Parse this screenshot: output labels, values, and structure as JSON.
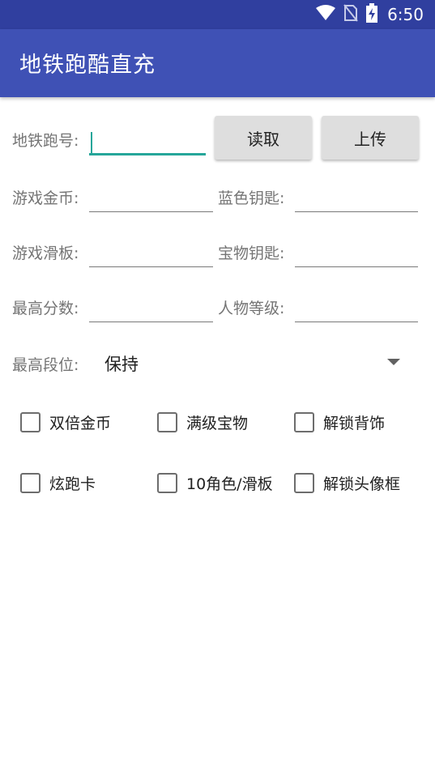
{
  "status_bar": {
    "time": "6:50",
    "icons": [
      "wifi-icon",
      "no-sim-icon",
      "battery-charging-icon"
    ]
  },
  "app_bar": {
    "title": "地铁跑酷直充"
  },
  "form": {
    "id_label": "地铁跑号:",
    "id_value": "",
    "read_button": "读取",
    "upload_button": "上传",
    "coins_label": "游戏金币:",
    "blue_keys_label": "蓝色钥匙:",
    "boards_label": "游戏滑板:",
    "treasure_keys_label": "宝物钥匙:",
    "high_score_label": "最高分数:",
    "level_label": "人物等级:",
    "rank_label": "最高段位:",
    "rank_selected": "保持"
  },
  "checkboxes": [
    {
      "label": "双倍金币",
      "checked": false
    },
    {
      "label": "满级宝物",
      "checked": false
    },
    {
      "label": "解锁背饰",
      "checked": false
    },
    {
      "label": "炫跑卡",
      "checked": false
    },
    {
      "label": "10角色/滑板",
      "checked": false
    },
    {
      "label": "解锁头像框",
      "checked": false
    }
  ]
}
